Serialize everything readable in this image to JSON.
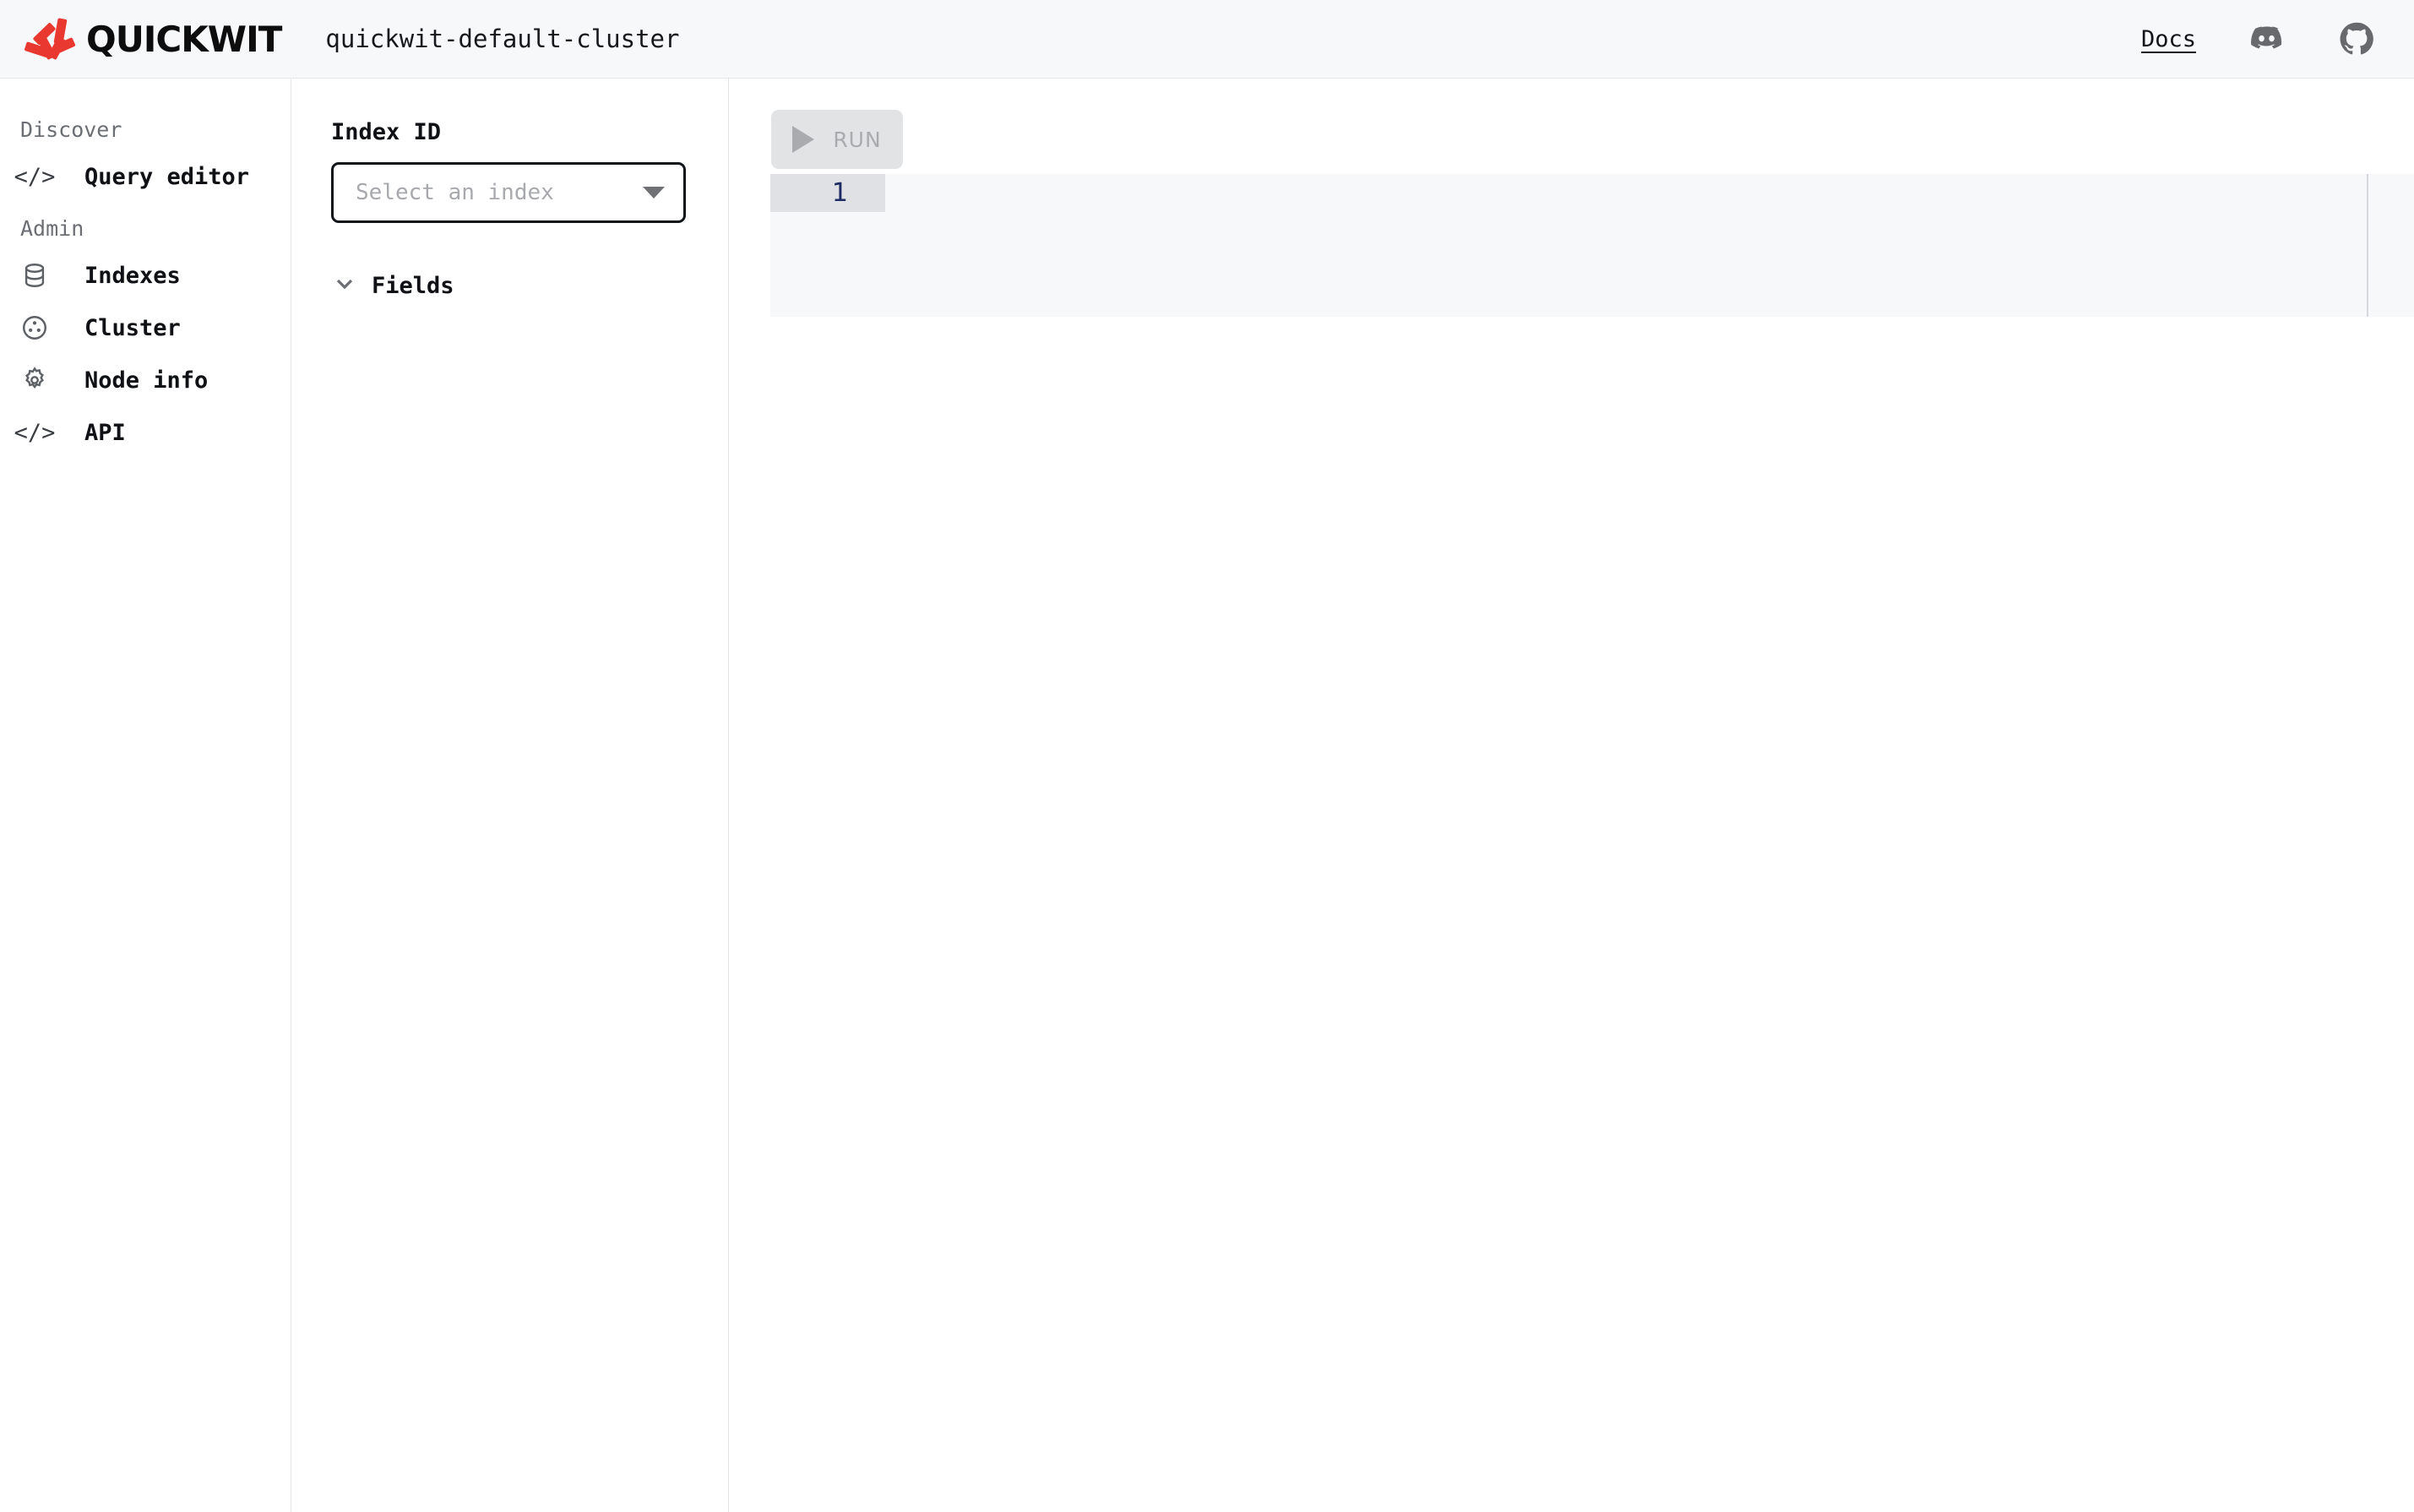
{
  "header": {
    "logo_text": "QUICKWIT",
    "logo_icon": "quickwit-pinwheel-logo",
    "cluster_name": "quickwit-default-cluster",
    "docs_label": "Docs",
    "discord_icon": "discord-icon",
    "github_icon": "github-icon",
    "background": "#f7f8fa",
    "brand_color": "#e8382f"
  },
  "sidebar": {
    "sections": [
      {
        "title": "Discover",
        "items": [
          {
            "label": "Query editor",
            "icon": "code-brackets-icon",
            "selected": true
          }
        ]
      },
      {
        "title": "Admin",
        "items": [
          {
            "label": "Indexes",
            "icon": "database-icon",
            "selected": false
          },
          {
            "label": "Cluster",
            "icon": "cluster-circle-icon",
            "selected": false
          },
          {
            "label": "Node info",
            "icon": "gear-icon",
            "selected": false
          },
          {
            "label": "API",
            "icon": "code-brackets-icon",
            "selected": false
          }
        ]
      }
    ]
  },
  "index_panel": {
    "index_id_label": "Index ID",
    "select_placeholder": "Select an index",
    "select_value": "",
    "select_arrow_icon": "chevron-down-icon",
    "fields_label": "Fields",
    "fields_chevron_icon": "chevron-down-icon",
    "fields_expanded": true,
    "fields_items": []
  },
  "main": {
    "run_label": "RUN",
    "run_icon": "play-triangle-icon",
    "run_disabled": true,
    "editor": {
      "line_numbers": [
        "1"
      ],
      "lines": [
        ""
      ],
      "background": "#f7f8fa",
      "gutter_background": "#dfe1e4",
      "line_number_color": "#1e2a63"
    }
  }
}
